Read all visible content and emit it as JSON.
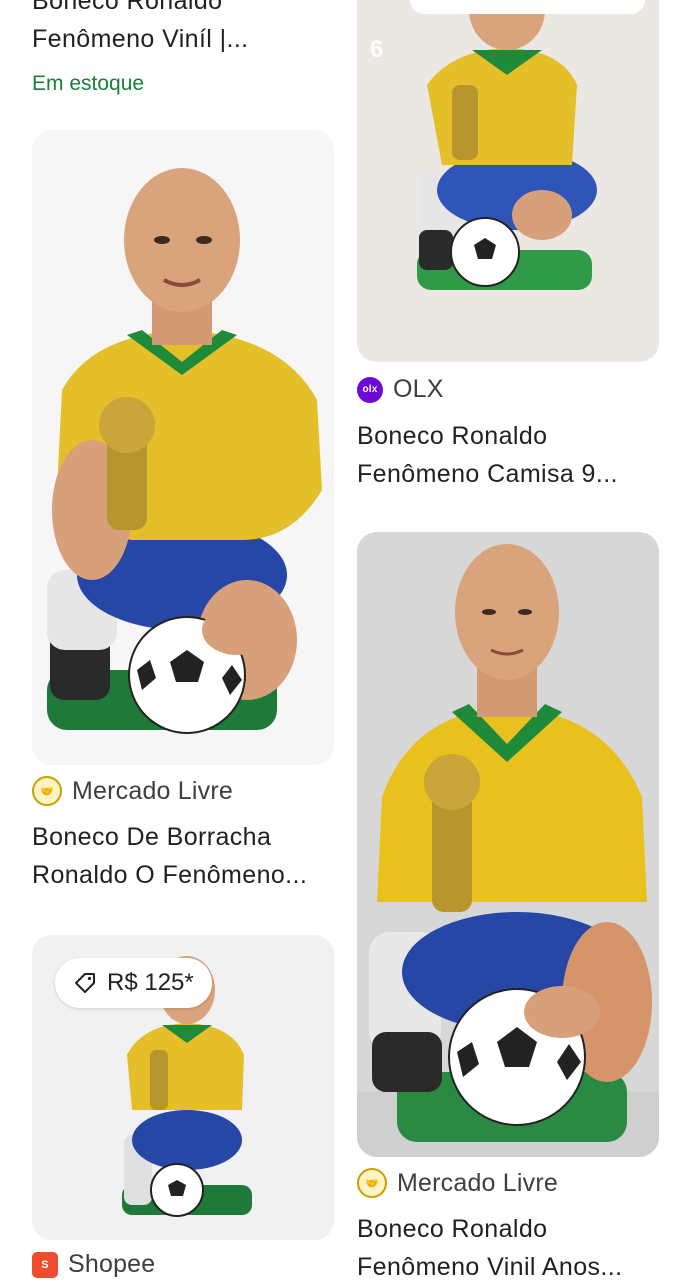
{
  "left": {
    "top_title_line1": "Boneco Ronaldo",
    "top_title_line2": "Fenômeno Viníl |...",
    "top_stock": "Em estoque",
    "card2": {
      "store": "Mercado Livre",
      "store_icon": "handshake-icon",
      "title_line1": "Boneco De Borracha",
      "title_line2": "Ronaldo O Fenômeno..."
    },
    "card3": {
      "price": "R$ 125*",
      "price_icon": "tag-icon",
      "store": "Shopee",
      "store_icon": "shopee-bag-icon"
    }
  },
  "right": {
    "card1": {
      "overlay_digit": "6",
      "store": "OLX",
      "store_icon": "olx-icon",
      "title_line1": "Boneco Ronaldo",
      "title_line2": "Fenômeno Camisa 9..."
    },
    "card2": {
      "store": "Mercado Livre",
      "store_icon": "handshake-icon",
      "title_line1": "Boneco Ronaldo",
      "title_line2": "Fenômeno Vinil Anos..."
    }
  },
  "colors": {
    "stock_green": "#188038",
    "jersey_yellow": "#e8c22a",
    "collar_green": "#1f8a3a",
    "shorts_blue": "#2747a6",
    "olx_purple": "#6e0ad6",
    "shopee_orange": "#ee4d2d"
  }
}
